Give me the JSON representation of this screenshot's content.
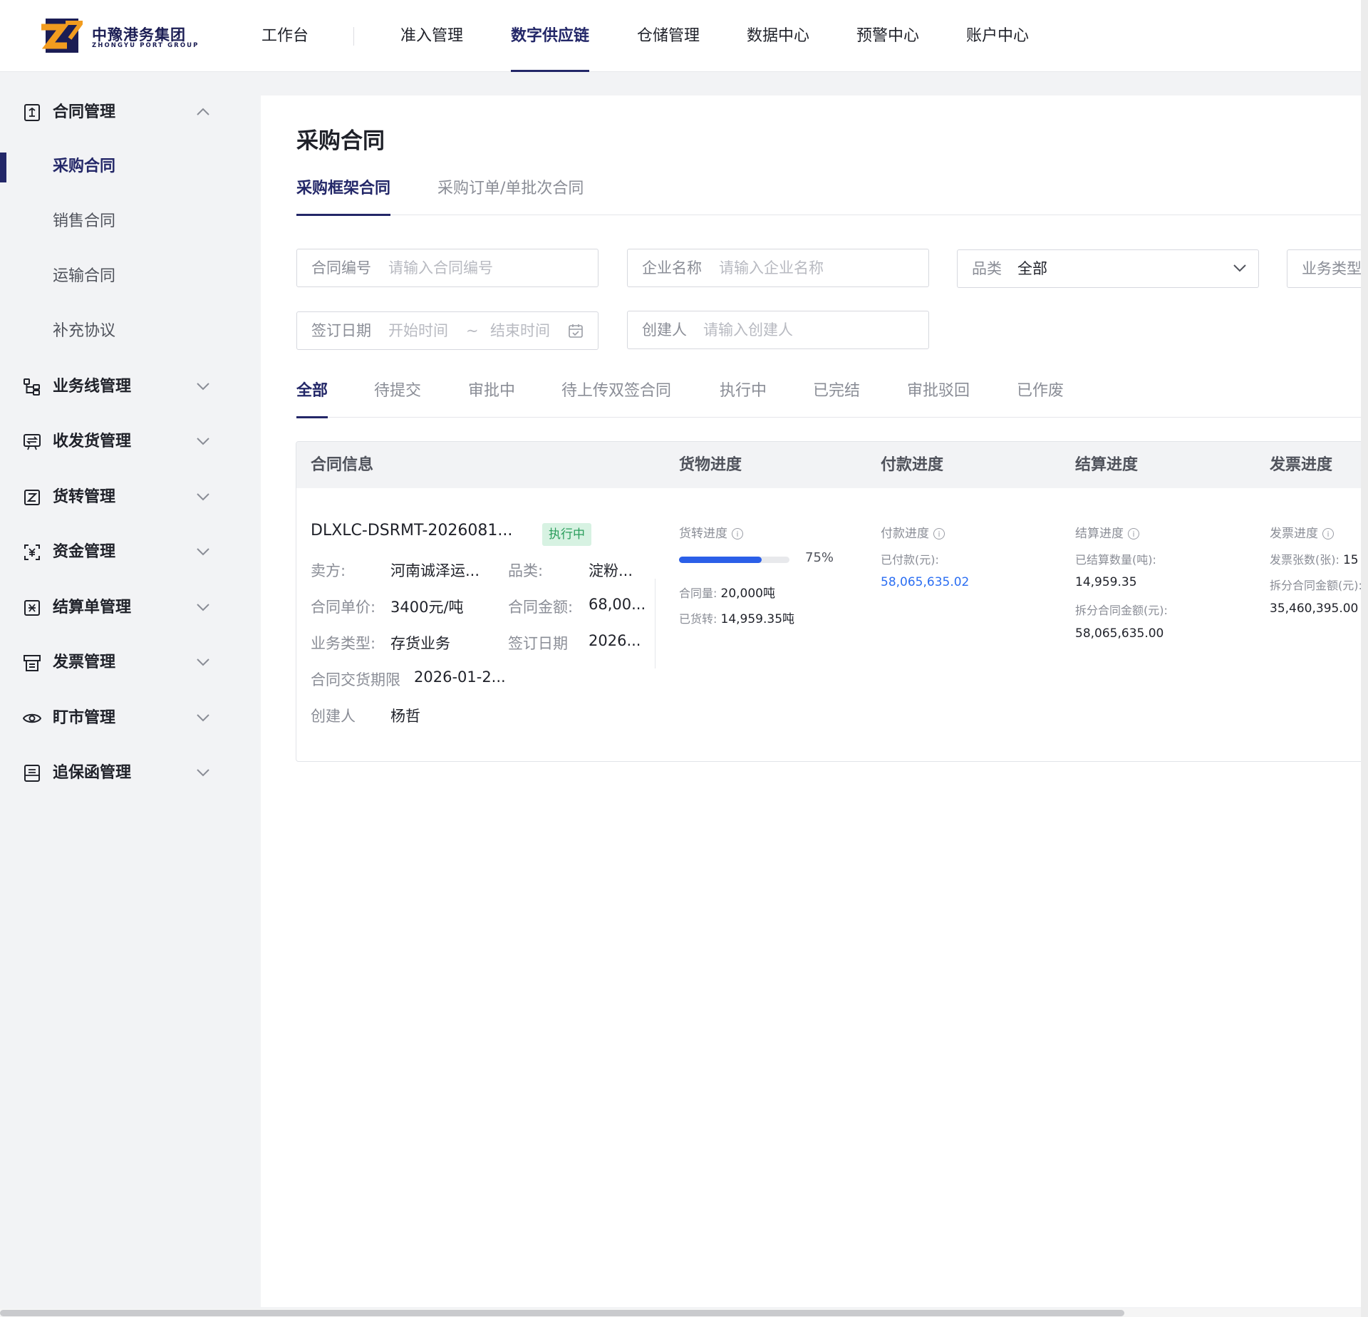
{
  "brand": {
    "name_cn": "中豫港务集团",
    "name_en": "ZHONGYU PORT GROUP",
    "colors": {
      "primary": "#232768",
      "accent": "#f29c1f",
      "blue_text": "#2b6ef2",
      "progress": "#2b5fe8",
      "badge_bg": "#d7f2e2",
      "badge_text": "#2a9d5c"
    }
  },
  "topnav": [
    {
      "label": "工作台"
    },
    {
      "label": "准入管理"
    },
    {
      "label": "数字供应链",
      "active": true
    },
    {
      "label": "仓储管理"
    },
    {
      "label": "数据中心"
    },
    {
      "label": "预警中心"
    },
    {
      "label": "账户中心"
    }
  ],
  "sidebar": {
    "groups": [
      {
        "label": "合同管理",
        "icon": "contract-icon",
        "expanded": true,
        "children": [
          {
            "label": "采购合同",
            "active": true
          },
          {
            "label": "销售合同"
          },
          {
            "label": "运输合同"
          },
          {
            "label": "补充协议"
          }
        ]
      },
      {
        "label": "业务线管理",
        "icon": "flow-icon"
      },
      {
        "label": "收发货管理",
        "icon": "shipping-icon"
      },
      {
        "label": "货转管理",
        "icon": "transfer-icon"
      },
      {
        "label": "资金管理",
        "icon": "fund-icon"
      },
      {
        "label": "结算单管理",
        "icon": "settlement-icon"
      },
      {
        "label": "发票管理",
        "icon": "invoice-icon"
      },
      {
        "label": "盯市管理",
        "icon": "eye-icon"
      },
      {
        "label": "追保函管理",
        "icon": "guarantee-icon"
      }
    ]
  },
  "page": {
    "title": "采购合同",
    "tabs": [
      {
        "label": "采购框架合同",
        "active": true
      },
      {
        "label": "采购订单/单批次合同"
      }
    ]
  },
  "filters": {
    "contract_no": {
      "label": "合同编号",
      "placeholder": "请输入合同编号"
    },
    "company": {
      "label": "企业名称",
      "placeholder": "请输入企业名称"
    },
    "category": {
      "label": "品类",
      "value": "全部"
    },
    "biz_type": {
      "label": "业务类型"
    },
    "sign_date": {
      "label": "签订日期",
      "start_placeholder": "开始时间",
      "separator": "~",
      "end_placeholder": "结束时间"
    },
    "creator": {
      "label": "创建人",
      "placeholder": "请输入创建人"
    }
  },
  "status_tabs": [
    {
      "label": "全部",
      "active": true
    },
    {
      "label": "待提交"
    },
    {
      "label": "审批中"
    },
    {
      "label": "待上传双签合同"
    },
    {
      "label": "执行中"
    },
    {
      "label": "已完结"
    },
    {
      "label": "审批驳回"
    },
    {
      "label": "已作废"
    }
  ],
  "table": {
    "headers": {
      "info": "合同信息",
      "goods": "货物进度",
      "payment": "付款进度",
      "settlement": "结算进度",
      "invoice": "发票进度"
    },
    "rows": [
      {
        "contract_no": "DLXLC-DSRMT-2026081...",
        "status": "执行中",
        "seller_k": "卖方:",
        "seller_v": "河南诚泽运...",
        "category_k": "品类:",
        "category_v": "淀粉...",
        "unit_price_k": "合同单价:",
        "unit_price_v": "3400元/吨",
        "amount_k": "合同金额:",
        "amount_v": "68,00...",
        "biz_type_k": "业务类型:",
        "biz_type_v": "存货业务",
        "sign_date_k": "签订日期",
        "sign_date_v": "2026...",
        "delivery_k": "合同交货期限",
        "delivery_v": "2026-01-2...",
        "creator_k": "创建人",
        "creator_v": "杨哲",
        "goods": {
          "title": "货转进度",
          "percent": 75,
          "percent_label": "75%",
          "contract_qty_k": "合同量:",
          "contract_qty_v": "20,000吨",
          "transferred_k": "已货转:",
          "transferred_v": "14,959.35吨"
        },
        "payment": {
          "title": "付款进度",
          "paid_k": "已付款(元):",
          "paid_v": "58,065,635.02"
        },
        "settlement": {
          "title": "结算进度",
          "qty_k": "已结算数量(吨):",
          "qty_v": "14,959.35",
          "split_k": "拆分合同金额(元):",
          "split_v": "58,065,635.00"
        },
        "invoice": {
          "title": "发票进度",
          "count_k": "发票张数(张):",
          "count_v": "15",
          "split_k": "拆分合同金额(元):",
          "split_v": "35,460,395.00"
        }
      }
    ]
  }
}
